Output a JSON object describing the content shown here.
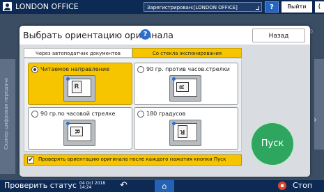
{
  "topbar": {
    "title": "LONDON OFFICE",
    "status": "Зарегистрирован:[LONDON OFFICE]",
    "help": "?",
    "logout": "Выйти",
    "moon": "(",
    "user_icon": "user-icon"
  },
  "dialog": {
    "title": "Выбрать ориентацию оригинала",
    "help": "?",
    "back_label": "Назад",
    "tabs": [
      {
        "label": "Через автоподатчик документов",
        "selected": false
      },
      {
        "label": "Со стекла экспонирования",
        "selected": true
      }
    ],
    "options": [
      {
        "label": "Читаемое направление",
        "selected": true,
        "glyph": "R"
      },
      {
        "label": "90 гр. против часов.стрелки",
        "selected": false,
        "glyph": "R"
      },
      {
        "label": "90 гр.по часовой стрелке",
        "selected": false,
        "glyph": "R"
      },
      {
        "label": "180 градусов",
        "selected": false,
        "glyph": "R"
      }
    ],
    "check_label": "Проверять ориентацию оригинала после каждого нажатия кнопки Пуск",
    "check_mark": "✔",
    "start_label": "Пуск"
  },
  "background": {
    "number": "0",
    "side_text": "Сканер цифровая передача"
  },
  "bottombar": {
    "status_label": "Проверить статус",
    "date": "04 Oct 2018",
    "time": "14:24",
    "back_icon": "back-arrow-icon",
    "home_icon": "home-icon",
    "stop_label": "Стоп"
  },
  "colors": {
    "accent": "#f7c500",
    "bar": "#0d2a55",
    "start": "#2ea65f"
  }
}
